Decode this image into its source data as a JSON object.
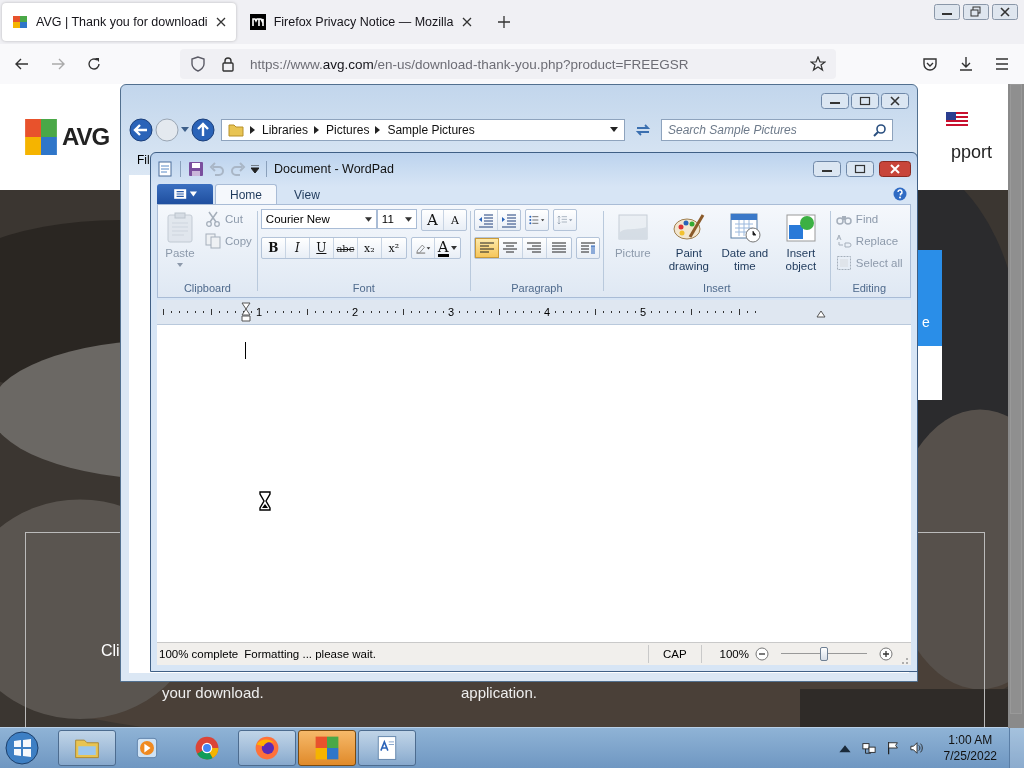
{
  "browser": {
    "tabs": [
      {
        "title": "AVG | Thank you for downloadi",
        "selected": true
      },
      {
        "title": "Firefox Privacy Notice — Mozilla",
        "selected": false
      }
    ],
    "url": {
      "prefix": "https://www.",
      "domain": "avg.com",
      "path": "/en-us/download-thank-you.php?product=FREEGSR"
    }
  },
  "page": {
    "logo": "AVG",
    "nav_fragment": "pport",
    "banner_fragment": "e",
    "left_fragment": "Cli",
    "captions": [
      "your download.",
      "application."
    ]
  },
  "explorer": {
    "menu_fragment": "Fil",
    "breadcrumb": [
      "Libraries",
      "Pictures",
      "Sample Pictures"
    ],
    "search": {
      "placeholder": "Search Sample Pictures"
    }
  },
  "wordpad": {
    "title": "Document - WordPad",
    "tabs": [
      {
        "label": "Home",
        "selected": true
      },
      {
        "label": "View",
        "selected": false
      }
    ],
    "clipboard": {
      "label": "Clipboard",
      "paste": {
        "label": "Paste",
        "disabled": true
      },
      "cut": {
        "label": "Cut",
        "disabled": true
      },
      "copy": {
        "label": "Copy",
        "disabled": true
      }
    },
    "font": {
      "label": "Font",
      "family": "Courier New",
      "size": "11",
      "grow": "A",
      "shrink": "A",
      "color_letter": "A",
      "styles": [
        {
          "kind": "bold",
          "label": "B"
        },
        {
          "kind": "italic",
          "label": "I"
        },
        {
          "kind": "underline",
          "label": "U"
        },
        {
          "kind": "strike",
          "label": "abc"
        },
        {
          "kind": "sub",
          "label": "x₂"
        },
        {
          "kind": "sup",
          "label": "x²"
        }
      ]
    },
    "paragraph": {
      "label": "Paragraph",
      "align": [
        {
          "kind": "left",
          "selected": true
        },
        {
          "kind": "center",
          "selected": false
        },
        {
          "kind": "right",
          "selected": false
        },
        {
          "kind": "justify",
          "selected": false
        }
      ]
    },
    "insert": {
      "label": "Insert",
      "items": [
        {
          "kind": "picture",
          "label": "Picture",
          "disabled": true
        },
        {
          "kind": "paint",
          "label": "Paint drawing",
          "disabled": false
        },
        {
          "kind": "datetime",
          "label": "Date and time",
          "disabled": false
        },
        {
          "kind": "object",
          "label": "Insert object",
          "disabled": false
        }
      ]
    },
    "editing": {
      "label": "Editing",
      "items": [
        {
          "kind": "find",
          "label": "Find",
          "disabled": true
        },
        {
          "kind": "replace",
          "label": "Replace",
          "disabled": true
        },
        {
          "kind": "selectall",
          "label": "Select all",
          "disabled": true
        }
      ]
    },
    "ruler": [
      "1",
      "2",
      "3",
      "4",
      "5"
    ],
    "status": {
      "progress": "100% complete",
      "message": "Formatting ... please wait.",
      "caps": "CAP",
      "zoom": "100%",
      "zoom_slider": {
        "level": 0.5
      }
    }
  },
  "taskbar": {
    "apps": [
      {
        "kind": "folder",
        "running": true,
        "selected": false
      },
      {
        "kind": "media",
        "running": false,
        "selected": false
      },
      {
        "kind": "chrome",
        "running": false,
        "selected": false
      },
      {
        "kind": "firefox",
        "running": true,
        "selected": false
      },
      {
        "kind": "avg",
        "running": true,
        "selected": true
      },
      {
        "kind": "wordpad",
        "running": true,
        "selected": false
      }
    ],
    "time": "1:00 AM",
    "date": "7/25/2022"
  }
}
